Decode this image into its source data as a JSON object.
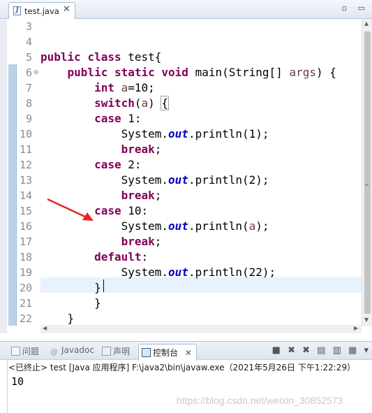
{
  "editor_tab": {
    "filename": "test.java",
    "close": "✕"
  },
  "window_controls": "▫ ▭",
  "code_lines": [
    {
      "num": "3",
      "text": ""
    },
    {
      "num": "4",
      "text": ""
    },
    {
      "num": "5",
      "text": "public class test{"
    },
    {
      "num": "6",
      "text": "    public static void main(String[] args) {"
    },
    {
      "num": "7",
      "text": "        int a=10;"
    },
    {
      "num": "8",
      "text": "        switch(a) {"
    },
    {
      "num": "9",
      "text": "        case 1:"
    },
    {
      "num": "10",
      "text": "            System.out.println(1);"
    },
    {
      "num": "11",
      "text": "            break;"
    },
    {
      "num": "12",
      "text": "        case 2:"
    },
    {
      "num": "13",
      "text": "            System.out.println(2);"
    },
    {
      "num": "14",
      "text": "            break;"
    },
    {
      "num": "15",
      "text": "        case 10:"
    },
    {
      "num": "16",
      "text": "            System.out.println(a);"
    },
    {
      "num": "17",
      "text": "            break;"
    },
    {
      "num": "18",
      "text": "        default:"
    },
    {
      "num": "19",
      "text": "            System.out.println(22);"
    },
    {
      "num": "20",
      "text": "        }"
    },
    {
      "num": "21",
      "text": "        }"
    },
    {
      "num": "22",
      "text": "    }"
    }
  ],
  "tokens": {
    "public": "public",
    "class": "class",
    "static": "static",
    "void": "void",
    "int": "int",
    "switch": "switch",
    "case": "case",
    "break": "break",
    "default": "default",
    "system": "System.",
    "out": "out",
    "println": ".println",
    "a": "a",
    "args": "args"
  },
  "console_tabs": [
    {
      "label": "问题"
    },
    {
      "label": "Javadoc"
    },
    {
      "label": "声明"
    },
    {
      "label": "控制台"
    }
  ],
  "console_status": "<已终止> test [Java 应用程序] F:\\java2\\bin\\javaw.exe（2021年5月26日 下午1:22:29）",
  "console_output": "10",
  "watermark": "https://blog.csdn.net/weixin_30852573",
  "colors": {
    "keyword": "#7f0055",
    "static_field": "#0000c0",
    "local_var": "#6a3e3e",
    "current_line": "#e8f2fe",
    "annotation_arrow": "#e8231f"
  },
  "icons": {
    "file": "java-file-icon",
    "problems": "problems-icon",
    "javadoc": "javadoc-icon",
    "declaration": "declaration-icon",
    "console": "console-icon"
  }
}
